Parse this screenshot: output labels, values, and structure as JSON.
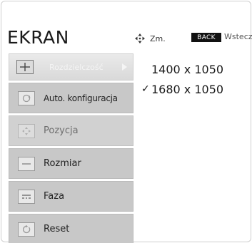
{
  "header": {
    "title": "EKRAN",
    "move_icon": "four-way-arrow-icon",
    "move_label": "Zm.",
    "back_badge": "BACK",
    "back_label": "Wstecz"
  },
  "menu": {
    "items": [
      {
        "label": "Rozdzielczość",
        "icon": "plus-crosshair-icon",
        "state": "selected"
      },
      {
        "label": "Auto. konfiguracja",
        "icon": "auto-config-circle-icon",
        "state": "enabled"
      },
      {
        "label": "Pozycja",
        "icon": "position-arrows-icon",
        "state": "disabled"
      },
      {
        "label": "Rozmiar",
        "icon": "size-bar-icon",
        "state": "enabled"
      },
      {
        "label": "Faza",
        "icon": "phase-lines-icon",
        "state": "enabled"
      },
      {
        "label": "Reset",
        "icon": "reset-circle-icon",
        "state": "enabled"
      }
    ]
  },
  "resolution": {
    "options": [
      {
        "value": "1400 x 1050",
        "checked": false
      },
      {
        "value": "1680 x 1050",
        "checked": true
      }
    ],
    "check_glyph": "✓"
  },
  "colors": {
    "selected_item_text": "#f4f4f4",
    "back_badge_bg": "#111111",
    "menu_item_bg": "#c8c8c8"
  }
}
